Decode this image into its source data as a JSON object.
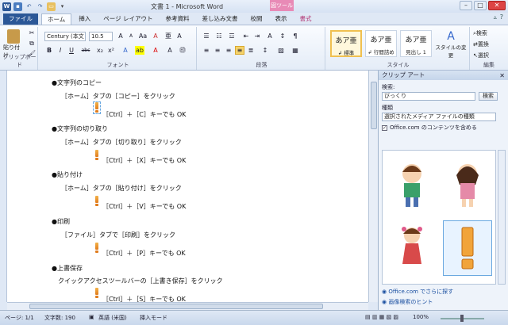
{
  "window": {
    "title": "文書 1 - Microsoft Word",
    "context_tab": "図ツール",
    "controls": [
      "–",
      "□",
      "✕"
    ]
  },
  "quick_access": {
    "word_icon": "W",
    "icons": [
      "save-icon",
      "undo-icon",
      "redo-icon",
      "open-icon",
      "print-icon"
    ]
  },
  "tabs": [
    {
      "label": "ファイル"
    },
    {
      "label": "ホーム"
    },
    {
      "label": "挿入"
    },
    {
      "label": "ページ レイアウト"
    },
    {
      "label": "参考資料"
    },
    {
      "label": "差し込み文書"
    },
    {
      "label": "校閲"
    },
    {
      "label": "表示"
    },
    {
      "label": "書式"
    }
  ],
  "ribbon": {
    "clipboard": {
      "label": "クリップボード",
      "paste": "貼り付け"
    },
    "font": {
      "label": "フォント",
      "name": "Century (本文",
      "size": "10.5",
      "bold": "B",
      "italic": "I",
      "underline": "U",
      "strike": "abc",
      "sub": "x₂",
      "sup": "x²"
    },
    "paragraph": {
      "label": "段落"
    },
    "styles": {
      "label": "スタイル",
      "items": [
        {
          "sample": "あア亜",
          "name": "↲ 標準"
        },
        {
          "sample": "あア亜",
          "name": "↲ 行間詰め"
        },
        {
          "sample": "あア亜",
          "name": "見出し 1"
        }
      ],
      "change": "スタイルの変更"
    },
    "editing": {
      "label": "編集",
      "find": "検索",
      "replace": "置換",
      "select": "選択"
    }
  },
  "document": {
    "lines": [
      "●文字列のコピー",
      "［ホーム］タブの［コピー］をクリック",
      "［Ctrl］＋［C］キーでも OK",
      "●文字列の切り取り",
      "［ホーム］タブの［切り取り］をクリック",
      "［Ctrl］＋［X］キーでも OK",
      "●貼り付け",
      "［ホーム］タブの［貼り付け］をクリック",
      "［Ctrl］＋［V］キーでも OK",
      "●印刷",
      "［ファイル］タブで［印刷］をクリック",
      "［Ctrl］＋［P］キーでも OK",
      "●上書保存",
      "クイックアクセスツールバーの［上書き保存］をクリック",
      "［Ctrl］＋［S］キーでも OK"
    ]
  },
  "clipart_pane": {
    "title": "クリップ アート",
    "search_label": "検索:",
    "search_value": "びっくり",
    "search_button": "検索",
    "type_label": "種類",
    "type_value": "選択されたメディア ファイルの種類",
    "office_checkbox": "Office.com のコンテンツを含める",
    "link_more": "Office.com でさらに探す",
    "link_hint": "画像検索のヒント"
  },
  "status": {
    "page": "ページ: 1/1",
    "words": "文字数: 190",
    "lang": "英語 (米国)",
    "mode": "挿入モード",
    "zoom": "100%"
  }
}
